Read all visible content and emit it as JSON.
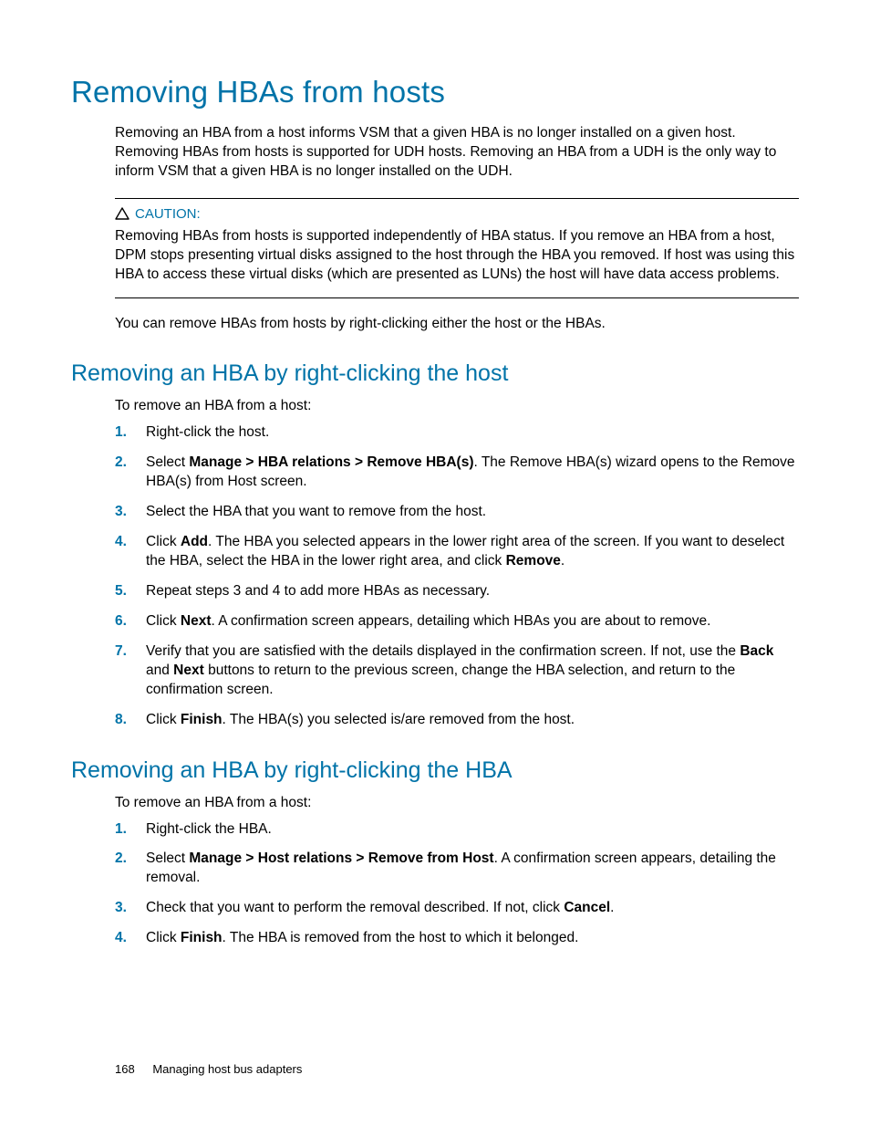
{
  "headings": {
    "h1": "Removing HBAs from hosts",
    "h2a": "Removing an HBA by right-clicking the host",
    "h2b": "Removing an HBA by right-clicking the HBA"
  },
  "paragraphs": {
    "p1": "Removing an HBA from a host informs VSM that a given HBA is no longer installed on a given host. Removing HBAs from hosts is supported for UDH hosts. Removing an HBA from a UDH is the only way to inform VSM that a given HBA is no longer installed on the UDH.",
    "p2": "You can remove HBAs from hosts by right-clicking either the host or the HBAs."
  },
  "caution": {
    "label": "CAUTION:",
    "text": "Removing HBAs from hosts is supported independently of HBA status. If you remove an HBA from a host, DPM stops presenting virtual disks assigned to the host through the HBA you removed. If host was using this HBA to access these virtual disks (which are presented as LUNs) the host will have data access problems."
  },
  "section_a": {
    "intro": "To remove an HBA from a host:",
    "steps": {
      "s1": "Right-click the host.",
      "s2a": "Select ",
      "s2b": "Manage > HBA relations > Remove HBA(s)",
      "s2c": ". The Remove HBA(s) wizard opens to the Remove HBA(s) from Host screen.",
      "s3": "Select the HBA that you want to remove from the host.",
      "s4a": "Click ",
      "s4b": "Add",
      "s4c": ". The HBA you selected appears in the lower right area of the screen. If you want to deselect the HBA, select the HBA in the lower right area, and click ",
      "s4d": "Remove",
      "s4e": ".",
      "s5": "Repeat steps 3 and 4 to add more HBAs as necessary.",
      "s6a": "Click ",
      "s6b": "Next",
      "s6c": ". A confirmation screen appears, detailing which HBAs you are about to remove.",
      "s7a": "Verify that you are satisfied with the details displayed in the confirmation screen. If not, use the ",
      "s7b": "Back",
      "s7c": " and ",
      "s7d": "Next",
      "s7e": " buttons to return to the previous screen, change the HBA selection, and return to the confirmation screen.",
      "s8a": "Click ",
      "s8b": "Finish",
      "s8c": ". The HBA(s) you selected is/are removed from the host."
    }
  },
  "section_b": {
    "intro": "To remove an HBA from a host:",
    "steps": {
      "s1": "Right-click the HBA.",
      "s2a": "Select ",
      "s2b": "Manage > Host relations > Remove from Host",
      "s2c": ". A confirmation screen appears, detailing the removal.",
      "s3a": "Check that you want to perform the removal described. If not, click ",
      "s3b": "Cancel",
      "s3c": ".",
      "s4a": "Click ",
      "s4b": "Finish",
      "s4c": ". The HBA is removed from the host to which it belonged."
    }
  },
  "footer": {
    "page": "168",
    "chapter": "Managing host bus adapters"
  }
}
